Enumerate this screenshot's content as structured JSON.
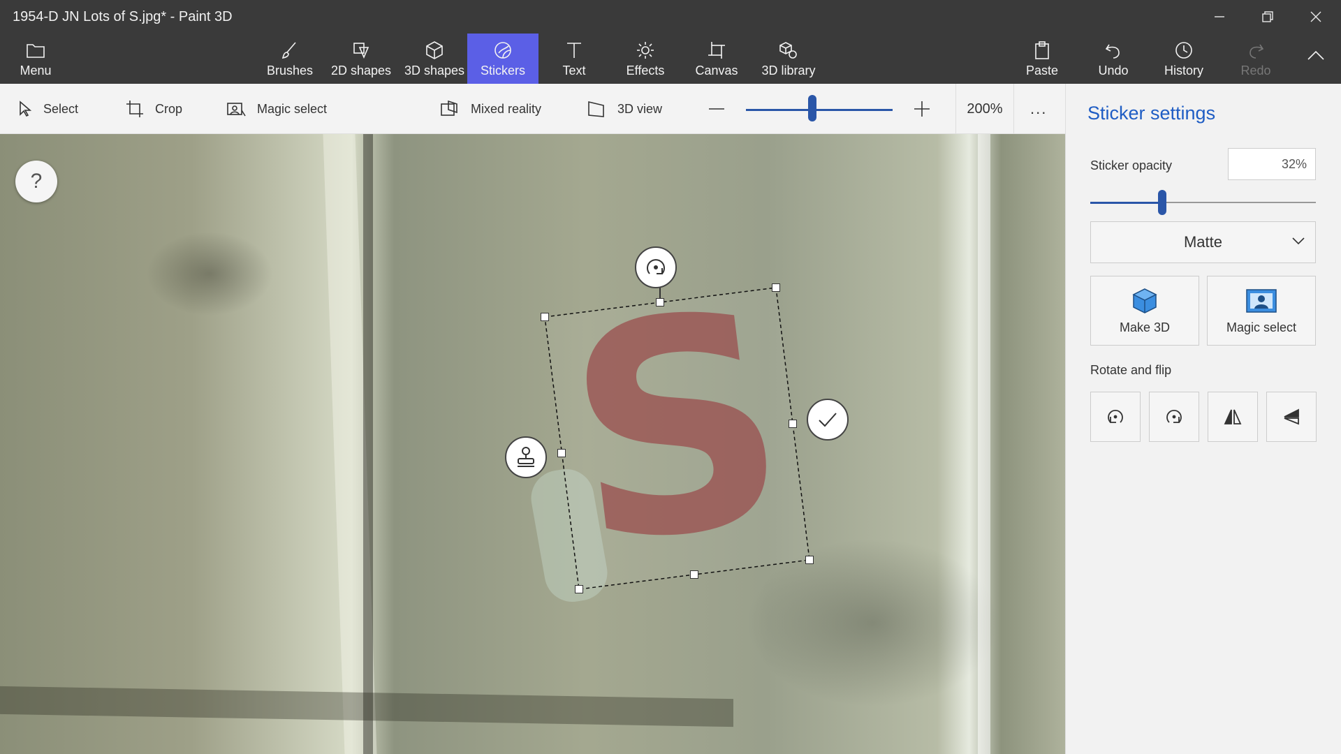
{
  "window": {
    "title": "1954-D JN Lots of S.jpg* - Paint 3D",
    "controls": [
      "minimize",
      "restore",
      "close"
    ]
  },
  "ribbon": {
    "menu_label": "Menu",
    "tabs": [
      {
        "label": "Brushes",
        "icon": "brush-icon"
      },
      {
        "label": "2D shapes",
        "icon": "2d-shapes-icon"
      },
      {
        "label": "3D shapes",
        "icon": "3d-shapes-icon"
      },
      {
        "label": "Stickers",
        "icon": "stickers-icon",
        "active": true
      },
      {
        "label": "Text",
        "icon": "text-icon"
      },
      {
        "label": "Effects",
        "icon": "effects-icon"
      },
      {
        "label": "Canvas",
        "icon": "canvas-icon"
      },
      {
        "label": "3D library",
        "icon": "3d-library-icon"
      }
    ],
    "actions": {
      "paste": "Paste",
      "undo": "Undo",
      "history": "History",
      "redo": "Redo"
    },
    "active_color": "#5b5fe6"
  },
  "toolbar": {
    "select": "Select",
    "crop": "Crop",
    "magic_select": "Magic select",
    "mixed_reality": "Mixed reality",
    "view_3d": "3D view",
    "zoom_value": "200%",
    "zoom_level": 0.45,
    "more": "..."
  },
  "canvas": {
    "help": "?",
    "sticker_letter": "S",
    "sticker_color": "#9a4e4e"
  },
  "panel": {
    "title": "Sticker settings",
    "opacity_label": "Sticker opacity",
    "opacity_value": "32%",
    "opacity": 0.32,
    "finish": "Matte",
    "make_3d": "Make 3D",
    "magic_select": "Magic select",
    "rotate_flip_label": "Rotate and flip",
    "accent_color": "#1f5dc4"
  }
}
